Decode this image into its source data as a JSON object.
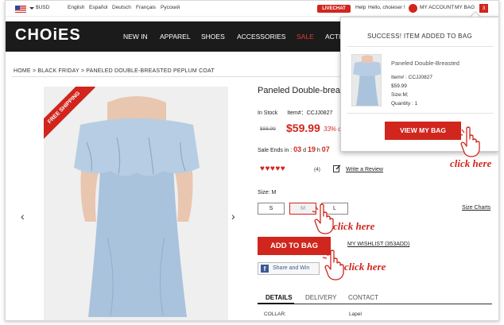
{
  "topbar": {
    "currency": "$USD",
    "languages": [
      "English",
      "Español",
      "Deutsch",
      "Français",
      "Русский"
    ],
    "livechat": "LIVECHAT",
    "help": "Help",
    "greeting": "Hello, choieser !",
    "account": "MY ACCOUNT",
    "bag": "MY BAG",
    "bag_count": "3"
  },
  "nav": {
    "logo": "CHOiES",
    "items": [
      "NEW IN",
      "APPAREL",
      "SHOES",
      "ACCESSORIES",
      "SALE",
      "ACTI"
    ]
  },
  "breadcrumb": "HOME > BLACK FRIDAY > PANELED DOUBLE-BREASTED PEPLUM COAT",
  "product": {
    "ribbon": "FREE SHIPPING",
    "title": "Paneled Double-breas",
    "stock": "In Stock",
    "item_no": "Item#：CCJJ0827",
    "orig_price": "$88.99",
    "price": "$59.99",
    "discount": "33% o",
    "sale_ends_label": "Sale Ends in :",
    "countdown": {
      "d": "03",
      "h": "19",
      "m": "07"
    },
    "hearts": "♥♥♥♥♥",
    "review_count": "(4)",
    "write_review": "Write a Review",
    "size_label": "Size: M",
    "sizes": [
      "S",
      "M",
      "L"
    ],
    "size_charts": "Size Charts",
    "add_to_bag": "ADD TO BAG",
    "wishlist": "MY WISHLIST (353ADD)",
    "share": "Share and Win",
    "tabs": [
      "DETAILS",
      "DELIVERY",
      "CONTACT"
    ],
    "detail_row": {
      "key": "COLLAR:",
      "value": "Lapel"
    }
  },
  "popup": {
    "title": "SUCCESS! ITEM ADDED TO BAG",
    "name": "Paneled Double-Breasted",
    "item": "Item# : CCJJ0827",
    "price": "$59.99",
    "size": "Size:M;",
    "quantity": "Quantity : 1",
    "button": "VIEW MY BAG"
  },
  "annotations": {
    "click_here": "click here"
  },
  "colors": {
    "accent": "#d0261d",
    "nav_bg": "#1b1b1b",
    "dress": "#a9c3dd"
  }
}
